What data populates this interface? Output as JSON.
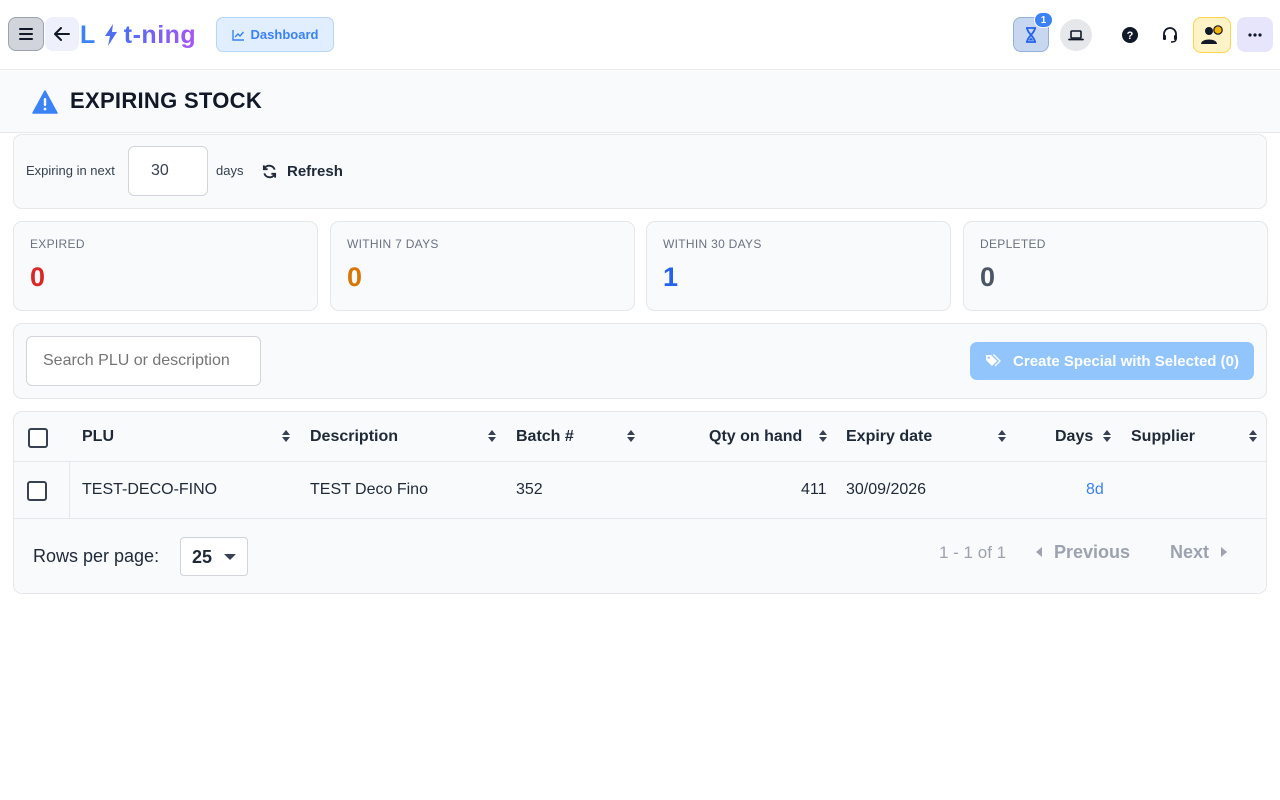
{
  "header": {
    "logo_left": "L",
    "logo_right": "t-ning",
    "dashboard_label": "Dashboard",
    "notification_count": "1",
    "icons": {
      "menu": "hamburger-icon",
      "back": "arrow-left-icon",
      "logo_bolt": "lightning-bolt-icon",
      "dashboard": "line-chart-icon",
      "hourglass": "hourglass-icon",
      "laptop": "laptop-icon",
      "help": "question-circle-icon",
      "support": "headset-icon",
      "user": "user-status-icon",
      "more": "ellipsis-icon"
    }
  },
  "page": {
    "title": "EXPIRING STOCK",
    "title_icon": "warning-triangle-icon"
  },
  "filter": {
    "prefix": "Expiring in next",
    "days_value": "30",
    "suffix": "days",
    "refresh_label": "Refresh",
    "refresh_icon": "refresh-icon"
  },
  "stats": [
    {
      "label": "EXPIRED",
      "value": "0",
      "color": "#dc2626"
    },
    {
      "label": "WITHIN 7 DAYS",
      "value": "0",
      "color": "#d97706"
    },
    {
      "label": "WITHIN 30 DAYS",
      "value": "1",
      "color": "#2563eb"
    },
    {
      "label": "DEPLETED",
      "value": "0",
      "color": "#4b5563"
    }
  ],
  "search": {
    "placeholder": "Search PLU or description",
    "special_button_label": "Create Special with Selected (0)",
    "special_icon": "tags-icon"
  },
  "table": {
    "columns": [
      "PLU",
      "Description",
      "Batch #",
      "Qty on hand",
      "Expiry date",
      "Days",
      "Supplier"
    ],
    "rows": [
      {
        "plu": "TEST-DECO-FINO",
        "description": "TEST Deco Fino",
        "batch": "352",
        "qty": "411",
        "expiry": "30/09/2026",
        "days": "8d",
        "supplier": ""
      }
    ]
  },
  "pagination": {
    "rows_per_page_label": "Rows per page:",
    "rows_per_page_value": "25",
    "range": "1 - 1 of 1",
    "previous_label": "Previous",
    "next_label": "Next"
  },
  "colors": {
    "accent": "#3b82f6",
    "disabled_button": "#93c5fd"
  }
}
